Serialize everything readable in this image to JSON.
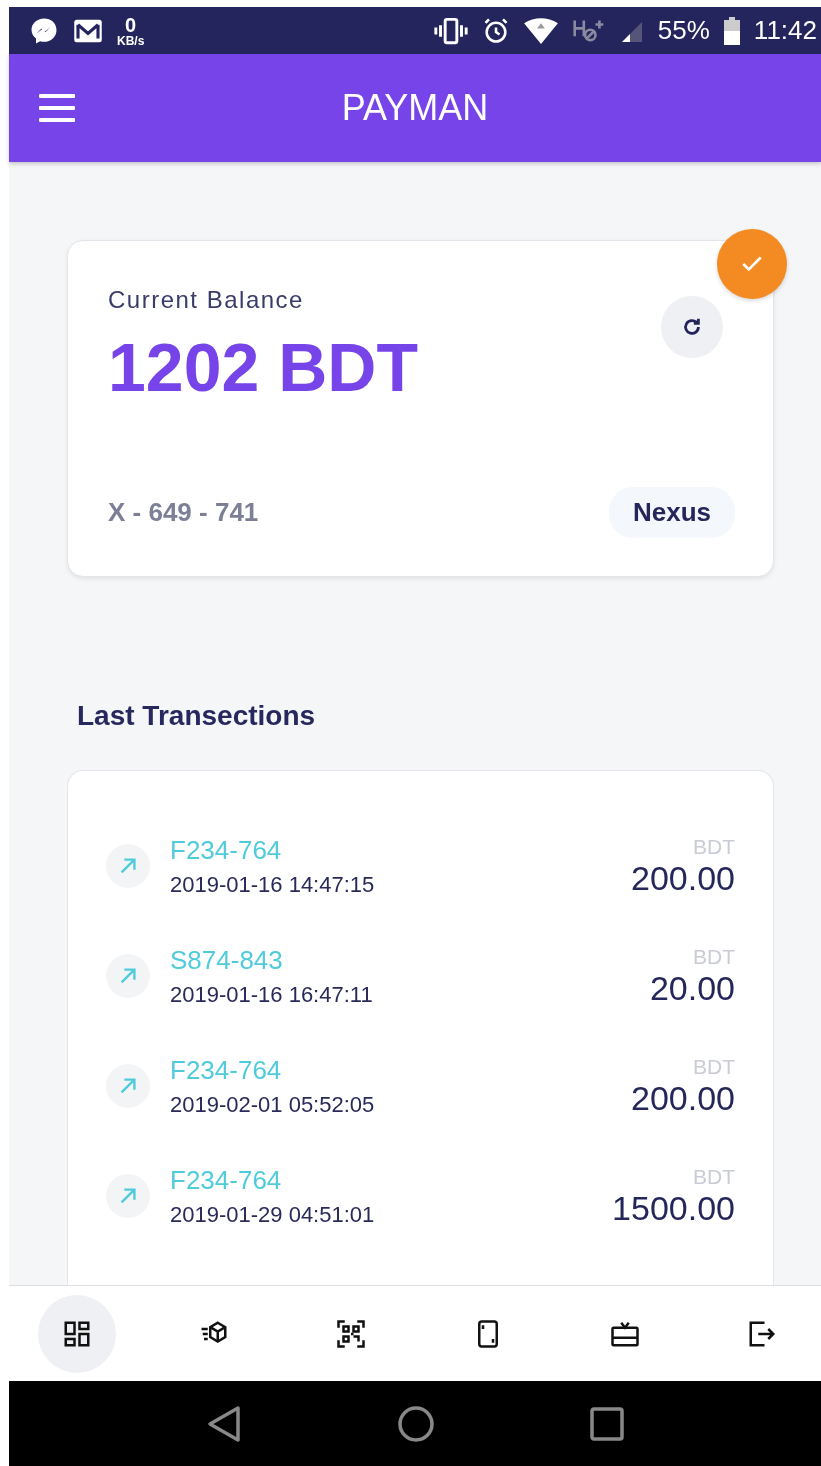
{
  "status_bar": {
    "speed_value": "0",
    "speed_unit": "KB/s",
    "battery_text": "55%",
    "time": "11:42"
  },
  "app_bar": {
    "title": "PAYMAN"
  },
  "balance_card": {
    "label": "Current Balance",
    "amount": "1202 BDT",
    "account": "X - 649 - 741",
    "provider": "Nexus"
  },
  "transactions_heading": "Last Transections",
  "transactions": [
    {
      "reference": "F234-764",
      "datetime": "2019-01-16 14:47:15",
      "currency": "BDT",
      "amount": "200.00"
    },
    {
      "reference": "S874-843",
      "datetime": "2019-01-16 16:47:11",
      "currency": "BDT",
      "amount": "20.00"
    },
    {
      "reference": "F234-764",
      "datetime": "2019-02-01 05:52:05",
      "currency": "BDT",
      "amount": "200.00"
    },
    {
      "reference": "F234-764",
      "datetime": "2019-01-29 04:51:01",
      "currency": "BDT",
      "amount": "1500.00"
    }
  ],
  "bottom_nav": [
    {
      "kind": "dashboard",
      "selected": true
    },
    {
      "kind": "delivery",
      "selected": false
    },
    {
      "kind": "qr",
      "selected": false
    },
    {
      "kind": "phone",
      "selected": false
    },
    {
      "kind": "gift",
      "selected": false
    },
    {
      "kind": "logout",
      "selected": false
    }
  ]
}
